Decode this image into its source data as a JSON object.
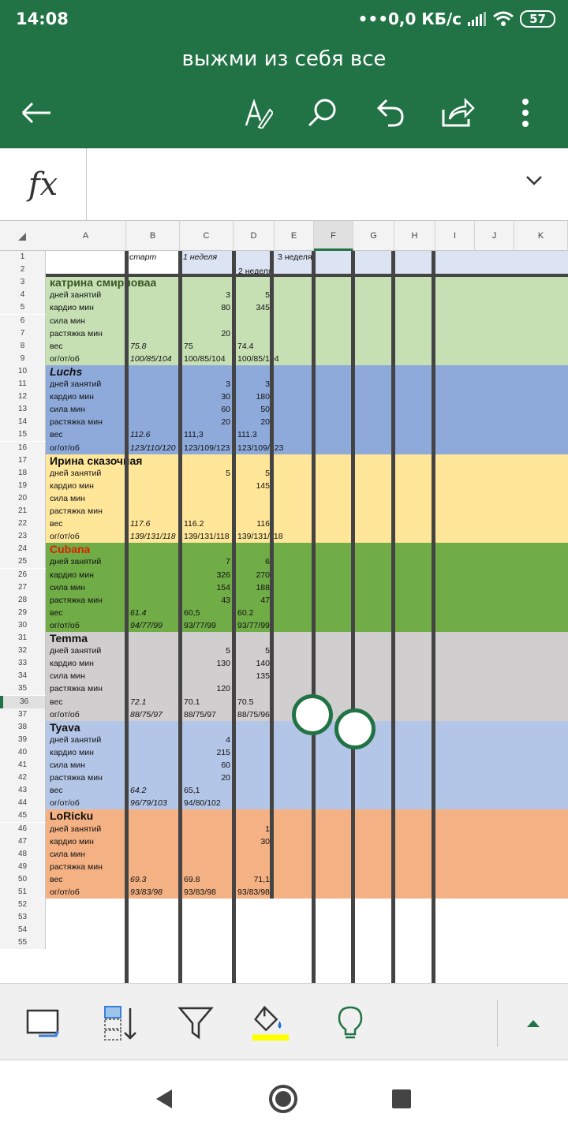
{
  "status_bar": {
    "time": "14:08",
    "network": "•••0,0 КБ/с",
    "battery": "57"
  },
  "header": {
    "title": "выжми из себя все"
  },
  "formula_bar": {
    "fx_label": "fx",
    "value": ""
  },
  "columns": [
    "A",
    "B",
    "C",
    "D",
    "E",
    "F",
    "G",
    "H",
    "I",
    "J",
    "K"
  ],
  "row_numbers": [
    "1",
    "2",
    "3",
    "4",
    "5",
    "6",
    "7",
    "8",
    "9",
    "10",
    "11",
    "12",
    "13",
    "14",
    "15",
    "16",
    "17",
    "18",
    "19",
    "20",
    "21",
    "22",
    "23",
    "24",
    "25",
    "26",
    "27",
    "28",
    "29",
    "30",
    "31",
    "32",
    "33",
    "34",
    "35",
    "36",
    "37",
    "38",
    "39",
    "40",
    "41",
    "42",
    "43",
    "44",
    "45",
    "46",
    "47",
    "48",
    "49",
    "50",
    "51",
    "52",
    "53",
    "54",
    "55"
  ],
  "header_rows": {
    "b1": "старт",
    "c1": "1 неделя",
    "e1": "3 неделя",
    "d2": "2 неделя"
  },
  "row_labels": [
    "дней занятий",
    "кардио мин",
    "сила мин",
    "растяжка мин",
    "вес",
    "ог/от/об"
  ],
  "people": [
    {
      "name": "катрина смирноваа",
      "color": "#c6e0b4",
      "name_color": "#375623",
      "values": [
        [
          "",
          "3",
          "5"
        ],
        [
          "",
          "80",
          "345"
        ],
        [
          "",
          "",
          ""
        ],
        [
          "",
          "20",
          ""
        ],
        [
          "75.8",
          "75",
          "74.4"
        ],
        [
          "100/85/104",
          "100/85/104",
          "100/85/104"
        ]
      ]
    },
    {
      "name": "Luchs",
      "color": "#8eaadb",
      "name_color": "#111111",
      "values": [
        [
          "",
          "3",
          "3"
        ],
        [
          "",
          "30",
          "180"
        ],
        [
          "",
          "60",
          "50"
        ],
        [
          "",
          "20",
          "20"
        ],
        [
          "112.6",
          "111,3",
          "111.3"
        ],
        [
          "123/110/120",
          "123/109/123",
          "123/109/123"
        ]
      ]
    },
    {
      "name": "Ирина сказочная",
      "color": "#ffe699",
      "name_color": "#111111",
      "values": [
        [
          "",
          "5",
          "5"
        ],
        [
          "",
          "",
          "145"
        ],
        [
          "",
          "",
          ""
        ],
        [
          "",
          "",
          ""
        ],
        [
          "117.6",
          "116.2",
          "116"
        ],
        [
          "139/131/118",
          "139/131/118",
          "139/131/118"
        ]
      ]
    },
    {
      "name": "Cubana",
      "color": "#70ad47",
      "name_color": "#e02000",
      "values": [
        [
          "",
          "7",
          "6"
        ],
        [
          "",
          "326",
          "270"
        ],
        [
          "",
          "154",
          "188"
        ],
        [
          "",
          "43",
          "47"
        ],
        [
          "61.4",
          "60,5",
          "60.2"
        ],
        [
          "94/77/99",
          "93/77/99",
          "93/77/99"
        ]
      ]
    },
    {
      "name": "Temma",
      "color": "#d0cece",
      "name_color": "#111111",
      "values": [
        [
          "",
          "5",
          "5"
        ],
        [
          "",
          "130",
          "140"
        ],
        [
          "",
          "",
          "135"
        ],
        [
          "",
          "120",
          ""
        ],
        [
          "72.1",
          "70.1",
          "70.5"
        ],
        [
          "88/75/97",
          "88/75/97",
          "88/75/96"
        ]
      ]
    },
    {
      "name": "Tyava",
      "color": "#b4c6e7",
      "name_color": "#111111",
      "values": [
        [
          "",
          "4",
          ""
        ],
        [
          "",
          "215",
          ""
        ],
        [
          "",
          "60",
          ""
        ],
        [
          "",
          "20",
          ""
        ],
        [
          "64.2",
          "65,1",
          ""
        ],
        [
          "96/79/103",
          "94/80/102",
          ""
        ]
      ]
    },
    {
      "name": "LoRicku",
      "color": "#f4b183",
      "name_color": "#111111",
      "values": [
        [
          "",
          "",
          "1"
        ],
        [
          "",
          "",
          "30"
        ],
        [
          "",
          "",
          ""
        ],
        [
          "",
          "",
          ""
        ],
        [
          "69.3",
          "69.8",
          "71,1"
        ],
        [
          "93/83/98",
          "93/83/98",
          "93/83/98"
        ]
      ]
    }
  ],
  "bottom_toolbar": [
    "select-icon",
    "sort-icon",
    "filter-icon",
    "fill-color-icon",
    "ideas-icon",
    "expand-icon"
  ],
  "colors": {
    "accent": "#217346",
    "fill_highlight": "#ffff00"
  }
}
